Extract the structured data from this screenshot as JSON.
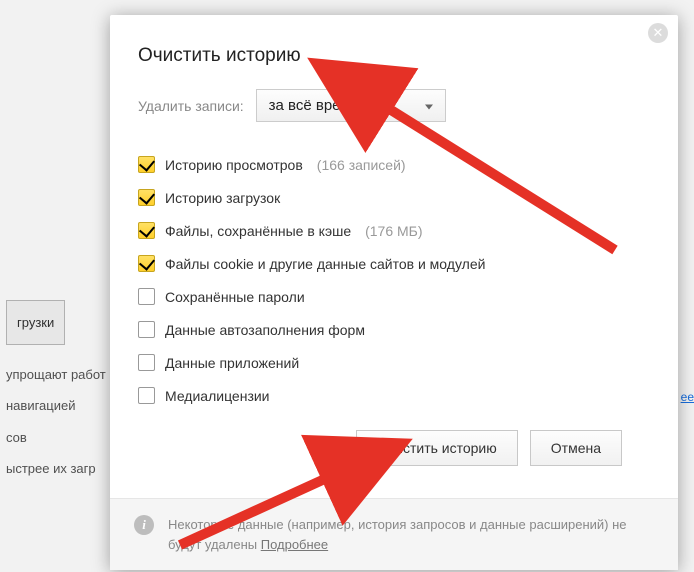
{
  "bg": {
    "btn_downloads": "грузки",
    "text1": "упрощают работ",
    "text2": "навигацией",
    "text3": "сов",
    "text4": "ыстрее их загр",
    "link_more": "ее"
  },
  "dialog": {
    "title": "Очистить историю",
    "delete_label": "Удалить записи:",
    "dropdown_value": "за всё время",
    "items": [
      {
        "label": "Историю просмотров",
        "meta": "(166 записей)",
        "checked": true
      },
      {
        "label": "Историю загрузок",
        "meta": "",
        "checked": true
      },
      {
        "label": "Файлы, сохранённые в кэше",
        "meta": "(176 МБ)",
        "checked": true
      },
      {
        "label": "Файлы cookie и другие данные сайтов и модулей",
        "meta": "",
        "checked": true
      },
      {
        "label": "Сохранённые пароли",
        "meta": "",
        "checked": false
      },
      {
        "label": "Данные автозаполнения форм",
        "meta": "",
        "checked": false
      },
      {
        "label": "Данные приложений",
        "meta": "",
        "checked": false
      },
      {
        "label": "Медиалицензии",
        "meta": "",
        "checked": false
      }
    ],
    "btn_clear": "Очистить историю",
    "btn_cancel": "Отмена",
    "footer_text": "Некоторые данные (например, история запросов и данные расширений) не будут удалены ",
    "footer_link": "Подробнее"
  }
}
